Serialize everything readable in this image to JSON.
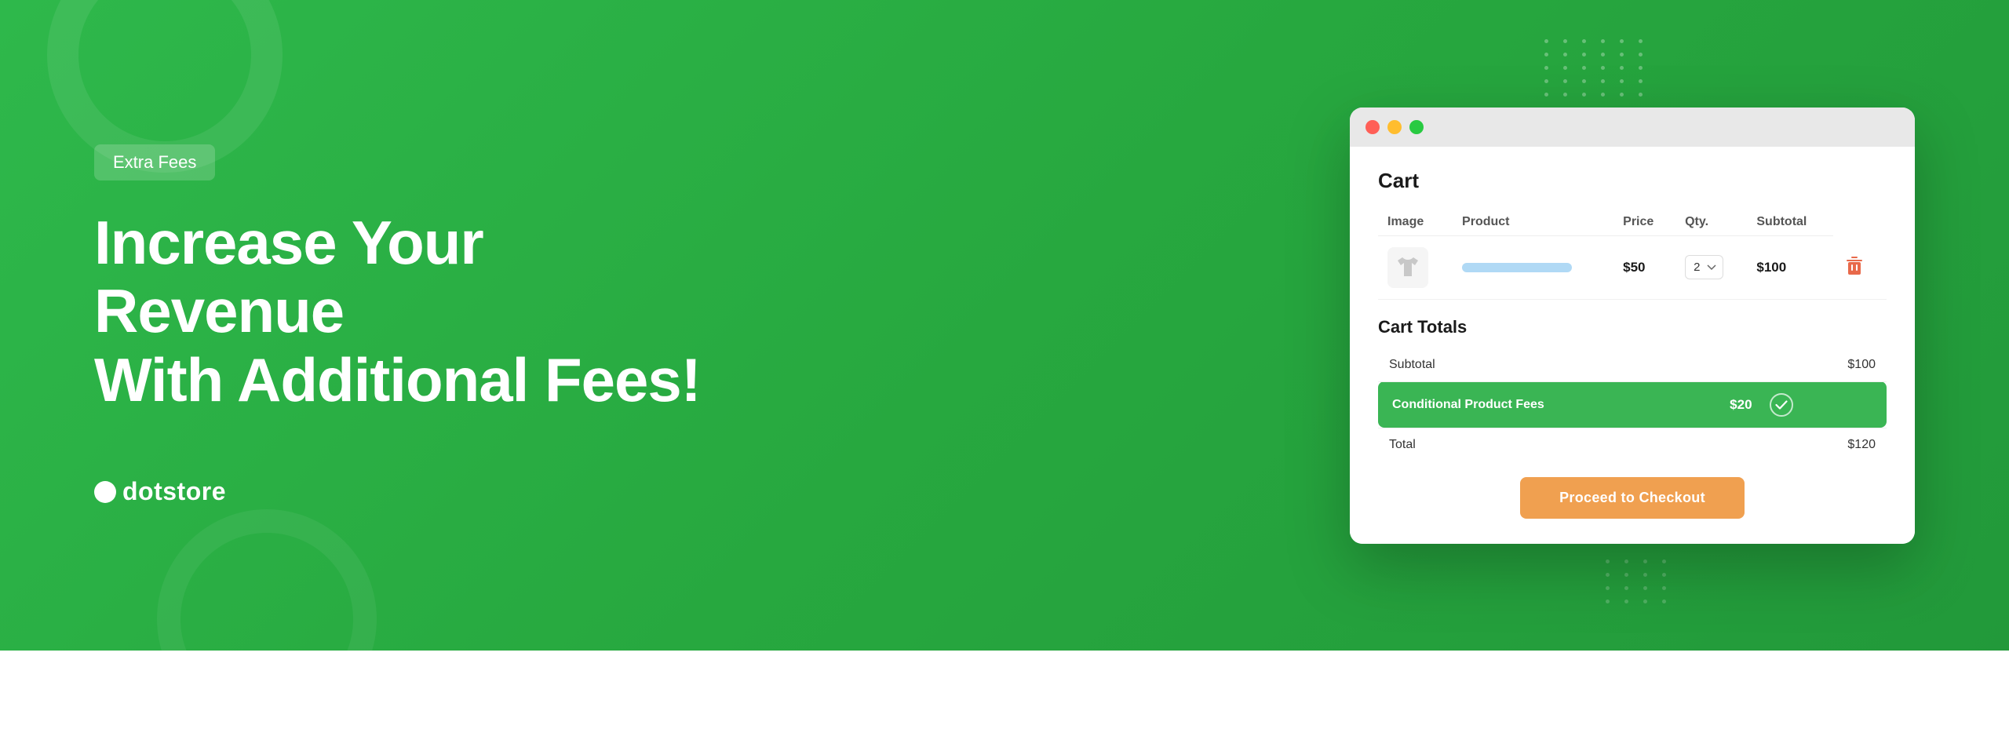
{
  "background": {
    "gradient_start": "#2eb84b",
    "gradient_end": "#22993a"
  },
  "badge": {
    "label": "Extra Fees"
  },
  "headline": {
    "line1": "Increase Your Revenue",
    "line2": "With Additional Fees!"
  },
  "logo": {
    "dot": "●",
    "text_plain": "dot",
    "text_bold": "store"
  },
  "browser": {
    "cart": {
      "title": "Cart",
      "columns": {
        "image": "Image",
        "product": "Product",
        "price": "Price",
        "qty": "Qty.",
        "subtotal": "Subtotal"
      },
      "row": {
        "price": "$50",
        "qty_value": "2",
        "subtotal": "$100"
      }
    },
    "cart_totals": {
      "title": "Cart Totals",
      "subtotal_label": "Subtotal",
      "subtotal_value": "$100",
      "fees_label": "Conditional Product Fees",
      "fees_value": "$20",
      "total_label": "Total",
      "total_value": "$120"
    },
    "checkout_button": "Proceed to Checkout"
  }
}
